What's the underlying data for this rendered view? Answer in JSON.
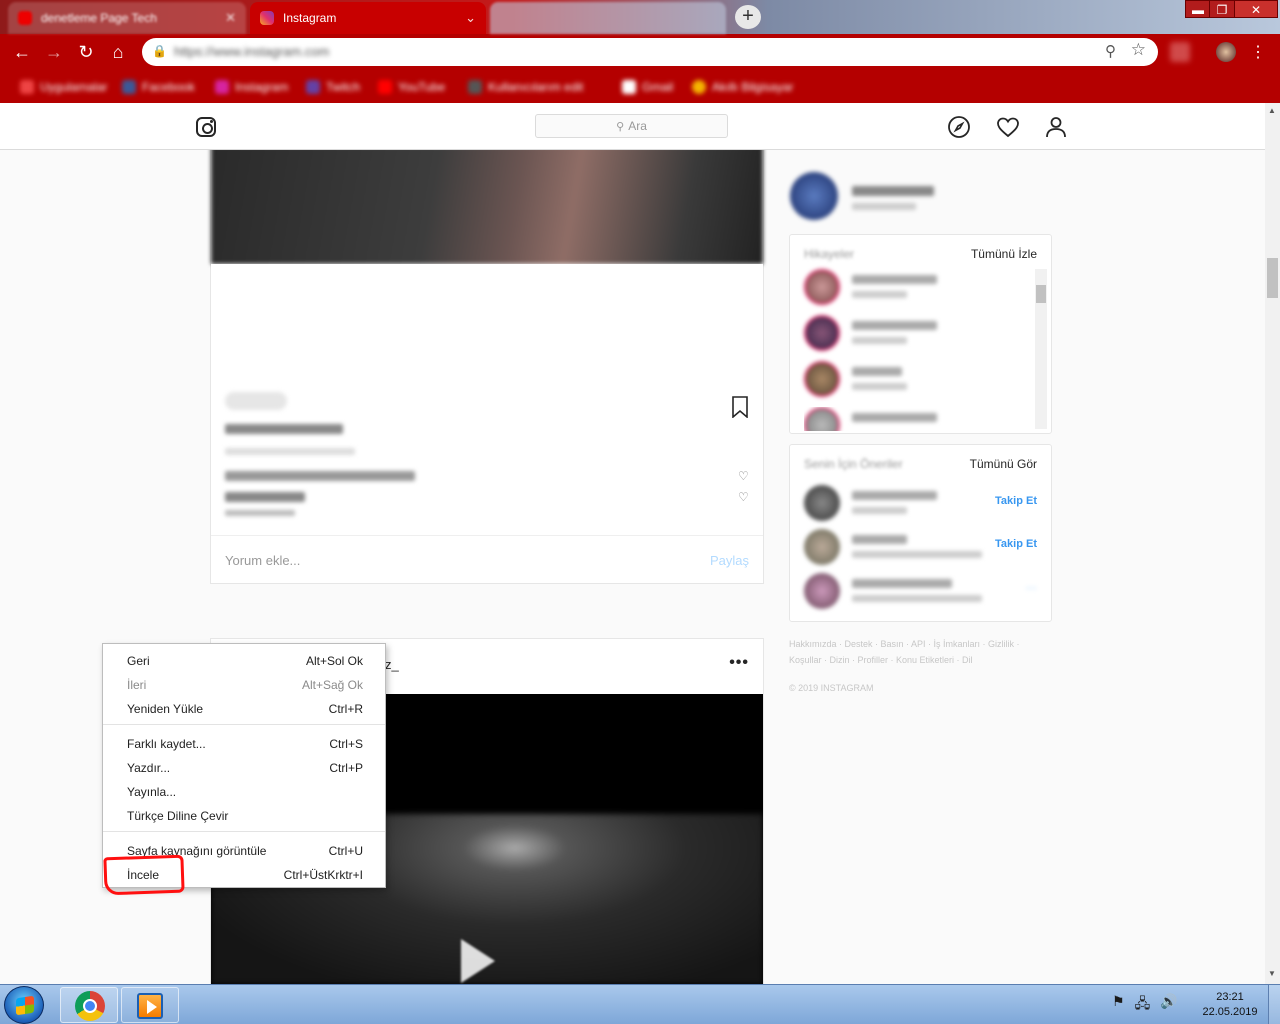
{
  "browser": {
    "tabs": [
      {
        "title": "denetleme Page Tech",
        "active": false
      },
      {
        "title": "Instagram",
        "active": true
      },
      {
        "title": "",
        "active": false
      }
    ],
    "new_tab": "+",
    "window_controls": {
      "minimize": "▬",
      "maximize": "❐",
      "close": "✕"
    },
    "url": "https://www.instagram.com",
    "bookmarks": [
      "Uygulamalar",
      "Facebook",
      "Instagram",
      "Twitch",
      "YouTube",
      "Kullanıcılarım edit",
      "Gmail",
      "Akıllı Bilgisayar"
    ]
  },
  "instagram": {
    "search_placeholder": "Ara",
    "search_icon": "search-icon",
    "nav_icons": [
      "compass-icon",
      "heart-icon",
      "profile-icon"
    ]
  },
  "post1": {
    "comment_placeholder": "Yorum ekle...",
    "share_label": "Paylaş"
  },
  "post2": {
    "username_fragment": "z_",
    "more_label": "•••"
  },
  "sidebar": {
    "stories_title": "Hikayeler",
    "stories_link": "Tümünü İzle",
    "suggestions_title": "Senin İçin Öneriler",
    "suggestions_link": "Tümünü Gör",
    "follow_label": "Takip Et",
    "footer": "Hakkımızda · Destek · Basın · API · İş İmkanları · Gizlilik · Koşullar · Dizin · Profiller · Konu Etiketleri · Dil",
    "copyright": "© 2019 INSTAGRAM"
  },
  "context_menu": {
    "items": [
      {
        "label": "Geri",
        "shortcut": "Alt+Sol Ok",
        "enabled": true
      },
      {
        "label": "İleri",
        "shortcut": "Alt+Sağ Ok",
        "enabled": false
      },
      {
        "label": "Yeniden Yükle",
        "shortcut": "Ctrl+R",
        "enabled": true
      },
      {
        "label": "Farklı kaydet...",
        "shortcut": "Ctrl+S",
        "enabled": true
      },
      {
        "label": "Yazdır...",
        "shortcut": "Ctrl+P",
        "enabled": true
      },
      {
        "label": "Yayınla...",
        "shortcut": "",
        "enabled": true
      },
      {
        "label": "Türkçe Diline Çevir",
        "shortcut": "",
        "enabled": true
      },
      {
        "label": "Sayfa kaynağını görüntüle",
        "shortcut": "Ctrl+U",
        "enabled": true
      },
      {
        "label": "İncele",
        "shortcut": "Ctrl+ÜstKrktr+I",
        "enabled": true
      }
    ]
  },
  "taskbar": {
    "time": "23:21",
    "date": "22.05.2019",
    "apps": [
      "chrome-icon",
      "media-player-icon"
    ]
  },
  "colors": {
    "chrome_theme": "#b40000",
    "ig_link": "#3897f0",
    "highlight": "#ff1010"
  }
}
